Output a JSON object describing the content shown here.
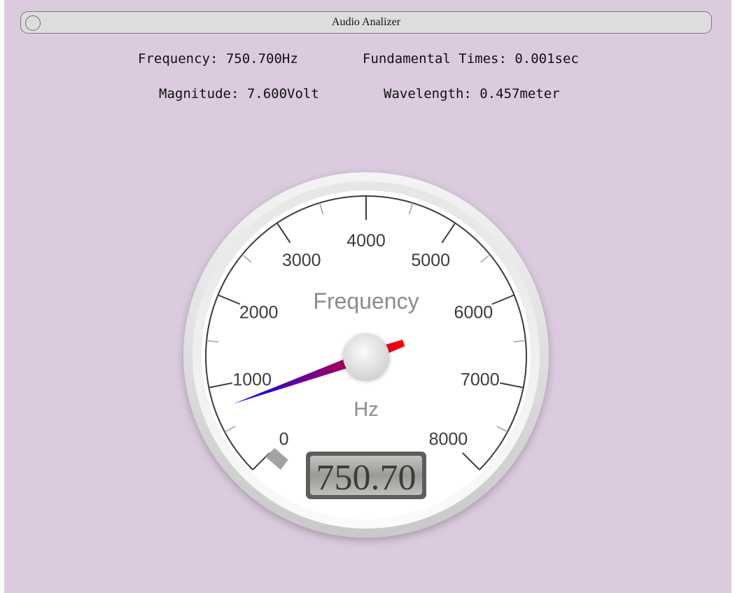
{
  "window": {
    "title": "Audio Analizer"
  },
  "readouts": {
    "frequency": "Frequency: 750.700Hz",
    "fundamental_times": "Fundamental Times: 0.001sec",
    "magnitude": "Magnitude: 7.600Volt",
    "wavelength": "Wavelength: 0.457meter"
  },
  "gauge": {
    "title": "Frequency",
    "units": "Hz",
    "min": 0,
    "max": 8000,
    "major_ticks": [
      "0",
      "1000",
      "2000",
      "3000",
      "4000",
      "5000",
      "6000",
      "7000",
      "8000"
    ],
    "value": 750.7,
    "display": "750.70",
    "needle_colors": {
      "tail": "#0000ff",
      "head": "#ff0000"
    }
  }
}
